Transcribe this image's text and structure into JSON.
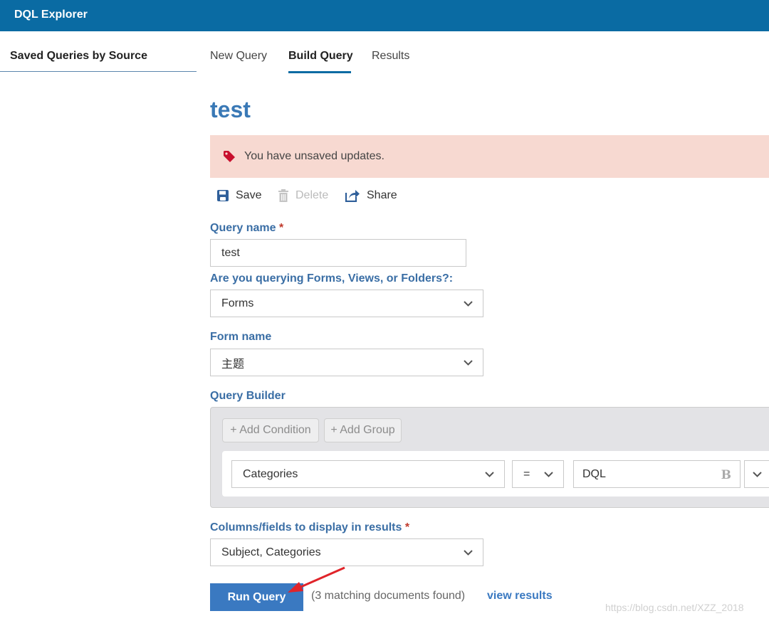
{
  "app": {
    "title": "DQL Explorer"
  },
  "sidebar": {
    "heading": "Saved Queries by Source"
  },
  "tabs": [
    {
      "label": "New Query",
      "active": false
    },
    {
      "label": "Build Query",
      "active": true
    },
    {
      "label": "Results",
      "active": false
    }
  ],
  "query": {
    "title": "test"
  },
  "banner": {
    "icon": "tag-icon",
    "text": "You have unsaved updates."
  },
  "actions": {
    "save": "Save",
    "delete": "Delete",
    "share": "Share"
  },
  "form": {
    "query_name_label": "Query name",
    "query_name_required": "*",
    "query_name_value": "test",
    "query_type_label": "Are you querying Forms, Views, or Folders?:",
    "query_type_value": "Forms",
    "form_name_label": "Form name",
    "form_name_value": "主题",
    "builder_label": "Query Builder",
    "columns_label": "Columns/fields to display in results",
    "columns_required": "*",
    "columns_value": "Subject, Categories"
  },
  "builder": {
    "add_condition": "+ Add Condition",
    "add_group": "+ Add Group",
    "field_value": "Categories",
    "operator_value": "=",
    "condition_value": "DQL",
    "value_type_badge": "B"
  },
  "footer": {
    "run_label": "Run Query",
    "match_text": "(3 matching documents found)",
    "view_results": "view results",
    "watermark": "https://blog.csdn.net/XZZ_2018"
  },
  "colors": {
    "header": "#0a6ba3",
    "accent": "#3a79c1",
    "banner": "#f7d9d1",
    "arrow": "#e0242a"
  }
}
